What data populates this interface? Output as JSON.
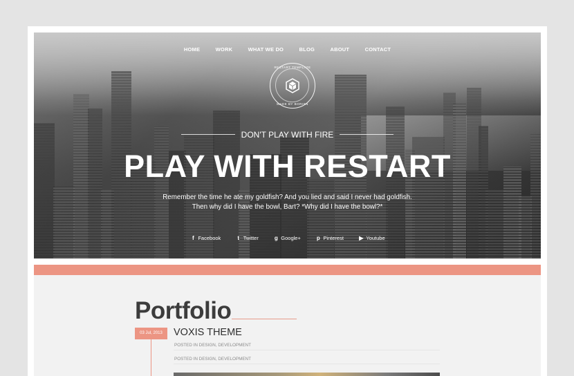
{
  "nav": {
    "items": [
      "HOME",
      "WORK",
      "WHAT WE DO",
      "BLOG",
      "ABOUT",
      "CONTACT"
    ]
  },
  "logo": {
    "top_text": "RESTART TEMPLATE",
    "bottom_text": "MADE BY BORISN"
  },
  "hero": {
    "subtitle": "DON'T PLAY WITH FIRE",
    "headline": "PLAY WITH RESTART",
    "quote_line1": "Remember the time he ate my goldfish? And you lied and said I never had goldfish.",
    "quote_line2": "Then why did I have the bowl, Bart? *Why did I have the bowl?*"
  },
  "social": [
    {
      "icon": "facebook-icon",
      "glyph": "f",
      "label": "Facebook"
    },
    {
      "icon": "twitter-icon",
      "glyph": "t",
      "label": "Twitter"
    },
    {
      "icon": "google-plus-icon",
      "glyph": "g",
      "label": "Google+"
    },
    {
      "icon": "pinterest-icon",
      "glyph": "p",
      "label": "Pinterest"
    },
    {
      "icon": "youtube-icon",
      "glyph": "▶",
      "label": "Youtube"
    }
  ],
  "portfolio": {
    "title": "Portfolio",
    "date": "03 Jul, 2013",
    "item_title": "VOXIS THEME",
    "meta1": "POSTED IN DESIGN, DEVELOPMENT",
    "meta2": "POSTED IN DESIGN, DEVELOPMENT"
  },
  "colors": {
    "accent": "#ec9583",
    "background": "#e4e4e4",
    "section_bg": "#f2f2f2"
  }
}
